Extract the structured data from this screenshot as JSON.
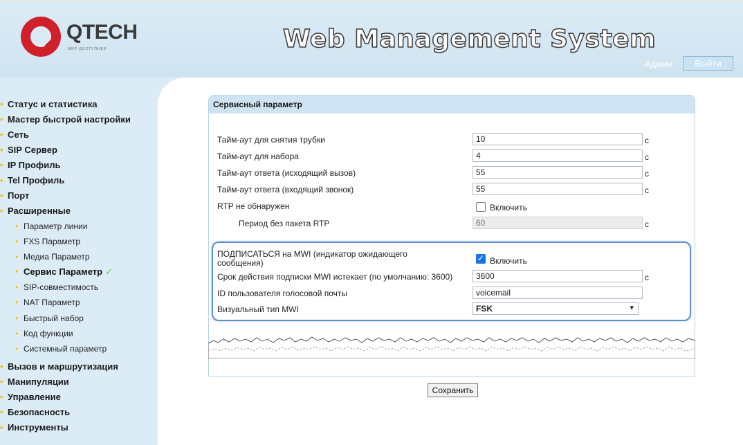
{
  "header": {
    "logo_text": "QTECH",
    "logo_subtext": "МИР ДОСТУПНЕЕ",
    "app_title": "Web Management System",
    "user_label": "Админ",
    "logout_label": "Выйти"
  },
  "sidebar": {
    "items": [
      {
        "label": "Статус и статистика"
      },
      {
        "label": "Мастер быстрой настройки"
      },
      {
        "label": "Сеть"
      },
      {
        "label": "SIP Сервер"
      },
      {
        "label": "IP Профиль"
      },
      {
        "label": "Tel Профиль"
      },
      {
        "label": "Порт"
      },
      {
        "label": "Расширенные"
      },
      {
        "label": "Параметр линии"
      },
      {
        "label": "FXS Параметр"
      },
      {
        "label": "Медиа Параметр"
      },
      {
        "label": "Сервис Параметр"
      },
      {
        "label": "SIP-совместимость"
      },
      {
        "label": "NAT Параметр"
      },
      {
        "label": "Быстрый набор"
      },
      {
        "label": "Код функции"
      },
      {
        "label": "Системный параметр"
      },
      {
        "label": "Вызов и маршрутизация"
      },
      {
        "label": "Манипуляции"
      },
      {
        "label": "Управление"
      },
      {
        "label": "Безопасность"
      },
      {
        "label": "Инструменты"
      }
    ]
  },
  "panel": {
    "title": "Сервисный параметр",
    "rows": {
      "offhook": {
        "label": "Тайм-аут для снятия трубки",
        "value": "10",
        "unit": "с"
      },
      "dial": {
        "label": "Тайм-аут для набора",
        "value": "4",
        "unit": "с"
      },
      "answer_out": {
        "label": "Тайм-аут ответа (исходящий вызов)",
        "value": "55",
        "unit": "с"
      },
      "answer_in": {
        "label": "Тайм-аут ответа (входящий звонок)",
        "value": "55",
        "unit": "с"
      },
      "rtp": {
        "label": "RTP не обнаружен",
        "checkbox_label": "Включить"
      },
      "rtp_period": {
        "label": "Период без пакета RTP",
        "value": "60",
        "unit": "с"
      },
      "mwi_sub": {
        "label_line1": "ПОДПИСАТЬСЯ на MWI (индикатор ожидающего",
        "label_line2": "сообщения)",
        "checkbox_label": "Включить"
      },
      "mwi_expire": {
        "label": "Срок действия подписки MWI истекает (по умолчанию: 3600)",
        "value": "3600",
        "unit": "с"
      },
      "voicemail": {
        "label": "ID пользователя голосовой почты",
        "value": "voicemail"
      },
      "mwi_type": {
        "label": "Визуальный тип MWI",
        "value": "FSK"
      }
    }
  },
  "save_label": "Сохранить",
  "colors": {
    "header_bg": "#dcecf6",
    "sidebar_bg": "#dcecf6",
    "bullet": "#f2c200",
    "logo_red": "#d0202c",
    "highlight": "#5b8fcf",
    "checkbox_checked": "#1a73e8"
  },
  "icons": {
    "active_item": "check-icon",
    "select": "chevron-down-icon"
  }
}
